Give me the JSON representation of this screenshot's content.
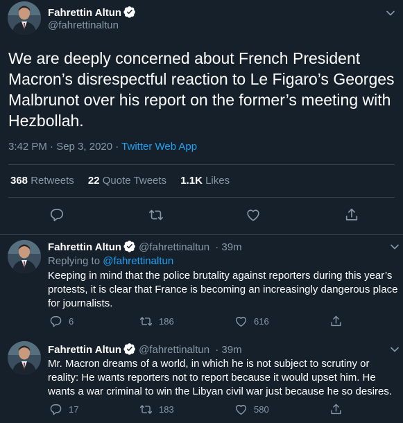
{
  "main_tweet": {
    "author_name": "Fahrettin Altun",
    "author_handle": "@fahrettinaltun",
    "text": "We are deeply concerned about French President Macron’s disrespectful reaction to Le Figaro’s Georges Malbrunot over his report on the former’s meeting with Hezbollah.",
    "timestamp": "3:42 PM · Sep 3, 2020 · ",
    "source_app": "Twitter Web App",
    "stats": {
      "retweets_count": "368",
      "retweets_label": "Retweets",
      "quote_tweets_count": "22",
      "quote_tweets_label": "Quote Tweets",
      "likes_count": "1.1K",
      "likes_label": "Likes"
    }
  },
  "replies": [
    {
      "author_name": "Fahrettin Altun",
      "author_handle": "@fahrettinaltun",
      "time_ago": "· 39m",
      "replying_prefix": "Replying to ",
      "replying_to": "@fahrettinaltun",
      "text": "Keeping in mind that the police brutality against reporters during this year’s protests, it is clear that France is becoming an increasingly dangerous place for journalists.",
      "reply_count": "6",
      "retweet_count": "186",
      "like_count": "616"
    },
    {
      "author_name": "Fahrettin Altun",
      "author_handle": "@fahrettinaltun",
      "time_ago": "· 39m",
      "text": "Mr. Macron dreams of a world, in which he is not subject to scrutiny or reality: He wants reporters not to report because it would upset him. He wants a war criminal to win the Libyan civil war just because he so desires.",
      "reply_count": "17",
      "retweet_count": "183",
      "like_count": "580"
    }
  ],
  "colors": {
    "background": "#15202b",
    "text_primary": "#ffffff",
    "text_secondary": "#8899a6",
    "accent": "#1da1f2",
    "divider": "#38444d"
  },
  "icons": [
    "verified-badge-icon",
    "chevron-down-icon",
    "reply-icon",
    "retweet-icon",
    "like-icon",
    "share-icon"
  ]
}
